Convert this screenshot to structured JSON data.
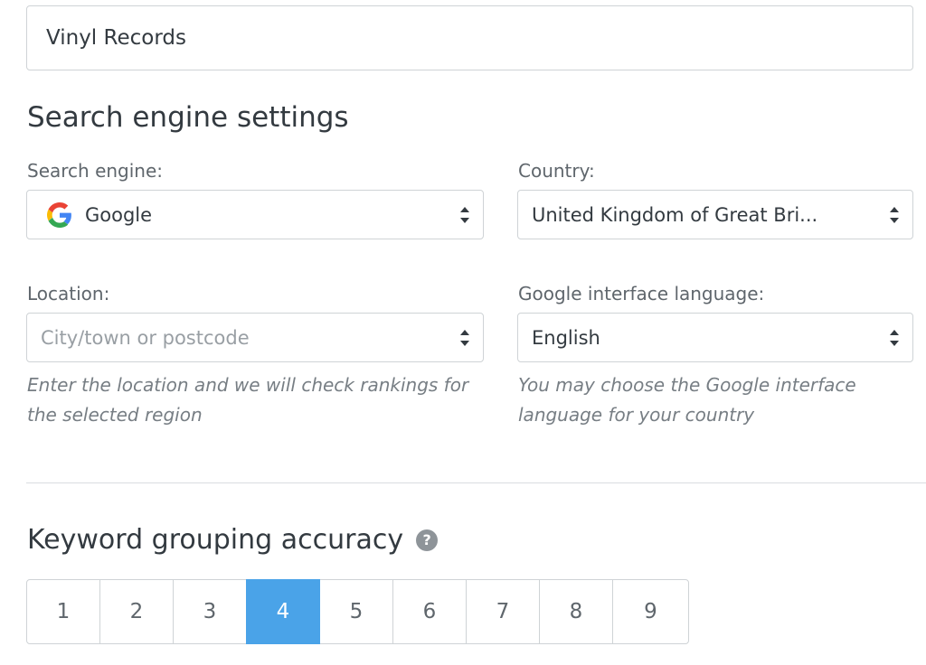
{
  "project": {
    "name": "Vinyl Records"
  },
  "search_settings": {
    "title": "Search engine settings",
    "search_engine": {
      "label": "Search engine:",
      "value": "Google",
      "icon": "google-logo-icon"
    },
    "country": {
      "label": "Country:",
      "value": "United Kingdom of Great Bri..."
    },
    "location": {
      "label": "Location:",
      "placeholder": "City/town or postcode",
      "hint": "Enter the location and we will check rankings for the selected region"
    },
    "language": {
      "label": "Google interface language:",
      "value": "English",
      "hint": "You may choose the Google interface language for your country"
    }
  },
  "grouping": {
    "title": "Keyword grouping accuracy",
    "help_icon": "?",
    "options": [
      "1",
      "2",
      "3",
      "4",
      "5",
      "6",
      "7",
      "8",
      "9"
    ],
    "selected": "4"
  },
  "colors": {
    "accent": "#4aa3e8",
    "border": "#cfd3d6",
    "text": "#333a40"
  }
}
